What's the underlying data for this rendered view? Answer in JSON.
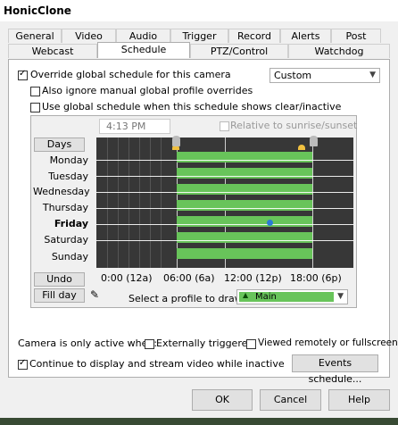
{
  "window": {
    "title": "HonicClone"
  },
  "tabs_row1": [
    "General",
    "Video",
    "Audio",
    "Trigger",
    "Record",
    "Alerts",
    "Post"
  ],
  "tabs_row2": [
    "Webcast",
    "Schedule",
    "PTZ/Control",
    "Watchdog"
  ],
  "active_tab": "Schedule",
  "schedule": {
    "override_label": "Override global schedule for this camera",
    "override_checked": true,
    "profile_mode": "Custom",
    "ignore_manual_label": "Also ignore manual global profile overrides",
    "ignore_manual_checked": false,
    "use_global_label": "Use global schedule when this schedule shows clear/inactive",
    "use_global_checked": false,
    "time_value": "4:13 PM",
    "relative_label": "Relative to sunrise/sunset",
    "days_button": "Days",
    "days": [
      "Monday",
      "Tuesday",
      "Wednesday",
      "Thursday",
      "Friday",
      "Saturday",
      "Sunday"
    ],
    "current_day": "Friday",
    "hour_labels": [
      "0:00 (12a)",
      "06:00 (6a)",
      "12:00 (12p)",
      "18:00 (6p)"
    ],
    "undo_button": "Undo",
    "fill_day_button": "Fill day",
    "draw_profile_label": "Select a profile to draw:",
    "draw_profile_value": "Main",
    "bar_color": "#68c45a"
  },
  "camera_active": {
    "label": "Camera is only active when:",
    "externally_triggered_label": "Externally triggered",
    "externally_triggered_checked": false,
    "viewed_remotely_label": "Viewed remotely or fullscreen",
    "viewed_remotely_checked": false,
    "continue_label": "Continue to display and stream video while inactive",
    "continue_checked": true,
    "events_button": "Events schedule..."
  },
  "footer": {
    "ok": "OK",
    "cancel": "Cancel",
    "help": "Help"
  }
}
